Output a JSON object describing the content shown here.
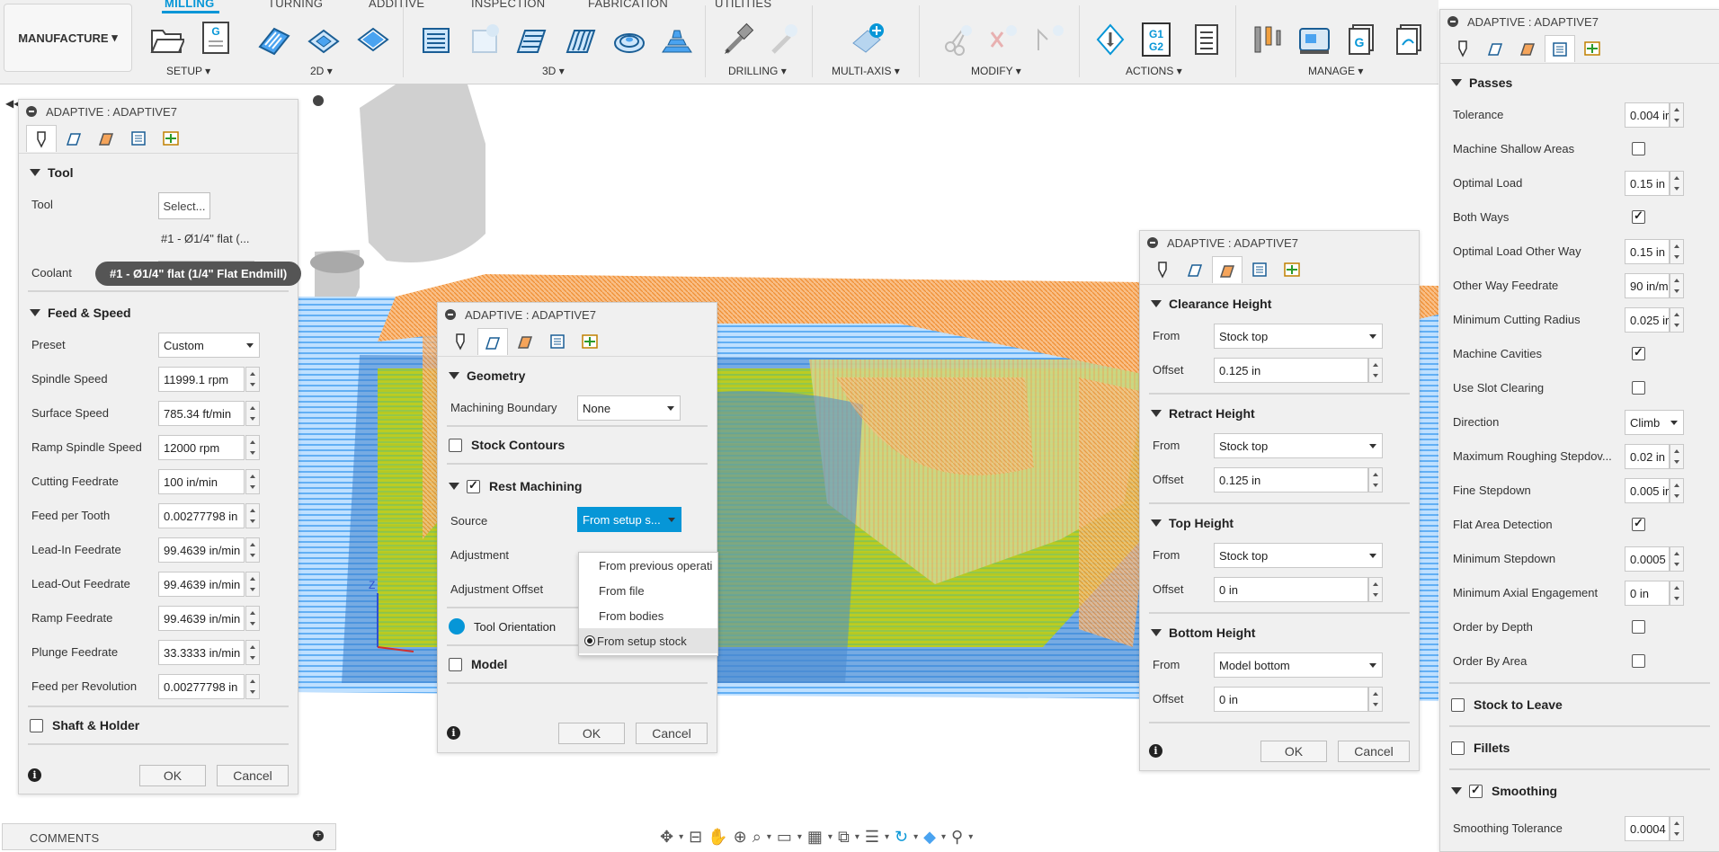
{
  "toolbar": {
    "workspace": "MANUFACTURE",
    "tabs": [
      "MILLING",
      "TURNING",
      "ADDITIVE",
      "INSPECTION",
      "FABRICATION",
      "UTILITIES"
    ],
    "groups": [
      "SETUP",
      "2D",
      "3D",
      "DRILLING",
      "MULTI-AXIS",
      "MODIFY",
      "ACTIONS",
      "MANAGE"
    ],
    "dropdown_suffix": "▾",
    "g1g2_label": "G1\nG2"
  },
  "left_panel": {
    "title": "ADAPTIVE : ADAPTIVE7",
    "tool_section": "Tool",
    "tool_label": "Tool",
    "select_button": "Select...",
    "tool_value": "#1 - Ø1/4\" flat (...",
    "coolant_label": "Coolant",
    "tooltip": "#1 - Ø1/4\" flat (1/4\" Flat Endmill)",
    "feed_section": "Feed & Speed",
    "fields": [
      {
        "label": "Preset",
        "value": "Custom"
      },
      {
        "label": "Spindle Speed",
        "value": "11999.1 rpm"
      },
      {
        "label": "Surface Speed",
        "value": "785.34 ft/min"
      },
      {
        "label": "Ramp Spindle Speed",
        "value": "12000 rpm"
      },
      {
        "label": "Cutting Feedrate",
        "value": "100 in/min"
      },
      {
        "label": "Feed per Tooth",
        "value": "0.00277798 in"
      },
      {
        "label": "Lead-In Feedrate",
        "value": "99.4639 in/min"
      },
      {
        "label": "Lead-Out Feedrate",
        "value": "99.4639 in/min"
      },
      {
        "label": "Ramp Feedrate",
        "value": "99.4639 in/min"
      },
      {
        "label": "Plunge Feedrate",
        "value": "33.3333 in/min"
      },
      {
        "label": "Feed per Revolution",
        "value": "0.00277798 in"
      }
    ],
    "shaft_section": "Shaft & Holder",
    "ok": "OK",
    "cancel": "Cancel"
  },
  "comments": {
    "label": "COMMENTS"
  },
  "geometry_panel": {
    "title": "ADAPTIVE : ADAPTIVE7",
    "geometry_section": "Geometry",
    "boundary_label": "Machining Boundary",
    "boundary_value": "None",
    "stock_contours": "Stock Contours",
    "rest_machining": "Rest Machining",
    "source_label": "Source",
    "source_value": "From setup s...",
    "adjustment_label": "Adjustment",
    "adjustment_offset_label": "Adjustment Offset",
    "source_options": [
      "From previous operati",
      "From file",
      "From bodies",
      "From setup stock"
    ],
    "tool_orientation": "Tool Orientation",
    "model": "Model",
    "ok": "OK",
    "cancel": "Cancel"
  },
  "heights_panel": {
    "title": "ADAPTIVE : ADAPTIVE7",
    "sections": [
      {
        "name": "Clearance Height",
        "from": "Stock top",
        "offset": "0.125 in"
      },
      {
        "name": "Retract Height",
        "from": "Stock top",
        "offset": "0.125 in"
      },
      {
        "name": "Top Height",
        "from": "Stock top",
        "offset": "0 in"
      },
      {
        "name": "Bottom Height",
        "from": "Model bottom",
        "offset": "0 in"
      }
    ],
    "from_label": "From",
    "offset_label": "Offset",
    "ok": "OK",
    "cancel": "Cancel"
  },
  "passes_panel": {
    "title": "ADAPTIVE : ADAPTIVE7",
    "passes_section": "Passes",
    "rows": [
      {
        "label": "Tolerance",
        "type": "input",
        "value": "0.004 ir"
      },
      {
        "label": "Machine Shallow Areas",
        "type": "checkbox",
        "checked": false
      },
      {
        "label": "Optimal Load",
        "type": "input",
        "value": "0.15 in"
      },
      {
        "label": "Both Ways",
        "type": "checkbox",
        "checked": true
      },
      {
        "label": "Optimal Load Other Way",
        "type": "input",
        "value": "0.15 in"
      },
      {
        "label": "Other Way Feedrate",
        "type": "input",
        "value": "90 in/mi"
      },
      {
        "label": "Minimum Cutting Radius",
        "type": "input",
        "value": "0.025 ir"
      },
      {
        "label": "Machine Cavities",
        "type": "checkbox",
        "checked": true
      },
      {
        "label": "Use Slot Clearing",
        "type": "checkbox",
        "checked": false
      },
      {
        "label": "Direction",
        "type": "select",
        "value": "Climb"
      },
      {
        "label": "Maximum Roughing Stepdov...",
        "type": "input",
        "value": "0.02 in"
      },
      {
        "label": "Fine Stepdown",
        "type": "input",
        "value": "0.005 ir"
      },
      {
        "label": "Flat Area Detection",
        "type": "checkbox",
        "checked": true
      },
      {
        "label": "Minimum Stepdown",
        "type": "input",
        "value": "0.0005"
      },
      {
        "label": "Minimum Axial Engagement",
        "type": "input",
        "value": "0 in"
      },
      {
        "label": "Order by Depth",
        "type": "checkbox",
        "checked": false
      },
      {
        "label": "Order By Area",
        "type": "checkbox",
        "checked": false
      }
    ],
    "stock_to_leave": "Stock to Leave",
    "fillets": "Fillets",
    "smoothing": "Smoothing",
    "smoothing_tolerance_label": "Smoothing Tolerance",
    "smoothing_tolerance_value": "0.0004"
  },
  "colors": {
    "accent": "#0696d7",
    "toolpath_orange": "#f5a45a",
    "toolpath_blue": "#4aa3f0",
    "model_yellow": "#c8d200",
    "panel_bg": "#f0f0f0"
  }
}
